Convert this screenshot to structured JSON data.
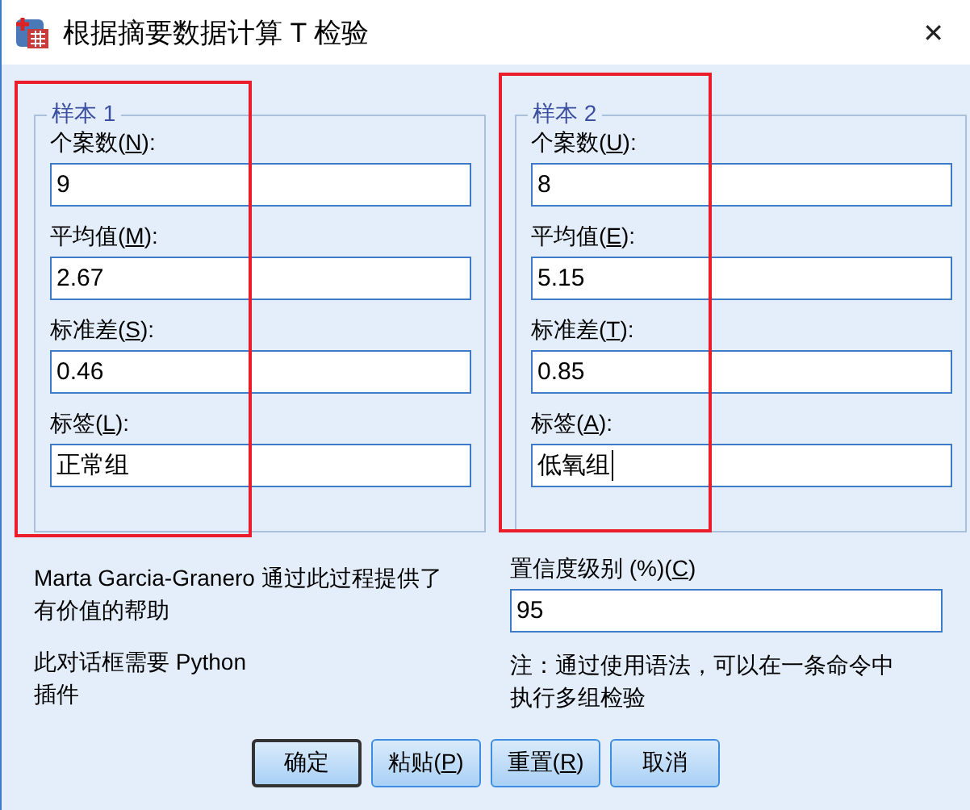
{
  "window": {
    "title": "根据摘要数据计算 T 检验",
    "close": "✕"
  },
  "samples": [
    {
      "title": "样本 1",
      "highlighted": true,
      "fields": [
        {
          "label_before": "个案数(",
          "access_key": "N",
          "label_after": "):",
          "value": "9",
          "focused": false
        },
        {
          "label_before": "平均值(",
          "access_key": "M",
          "label_after": "):",
          "value": "2.67",
          "focused": false
        },
        {
          "label_before": "标准差(",
          "access_key": "S",
          "label_after": "):",
          "value": "0.46",
          "focused": false
        },
        {
          "label_before": "标签(",
          "access_key": "L",
          "label_after": "):",
          "value": "正常组",
          "focused": false
        }
      ]
    },
    {
      "title": "样本 2",
      "highlighted": true,
      "fields": [
        {
          "label_before": "个案数(",
          "access_key": "U",
          "label_after": "):",
          "value": "8",
          "focused": false
        },
        {
          "label_before": "平均值(",
          "access_key": "E",
          "label_after": "):",
          "value": "5.15",
          "focused": false
        },
        {
          "label_before": "标准差(",
          "access_key": "T",
          "label_after": "):",
          "value": "0.85",
          "focused": false
        },
        {
          "label_before": "标签(",
          "access_key": "A",
          "label_after": "):",
          "value": "低氧组",
          "focused": true
        }
      ]
    }
  ],
  "credits": "Marta Garcia-Granero 通过此过程提供了有价值的帮助",
  "requirement": "此对话框需要 Python 插件",
  "confidence": {
    "label_before": "置信度级别 (%)(",
    "access_key": "C",
    "label_after": ")",
    "value": "95"
  },
  "note": "注：通过使用语法，可以在一条命令中执行多组检验",
  "buttons": [
    {
      "label": "确定",
      "default": true
    },
    {
      "label": "粘贴(",
      "access_key": "P",
      "label_after": ")",
      "default": false
    },
    {
      "label": "重置(",
      "access_key": "R",
      "label_after": ")",
      "default": false
    },
    {
      "label": "取消",
      "default": false
    }
  ]
}
